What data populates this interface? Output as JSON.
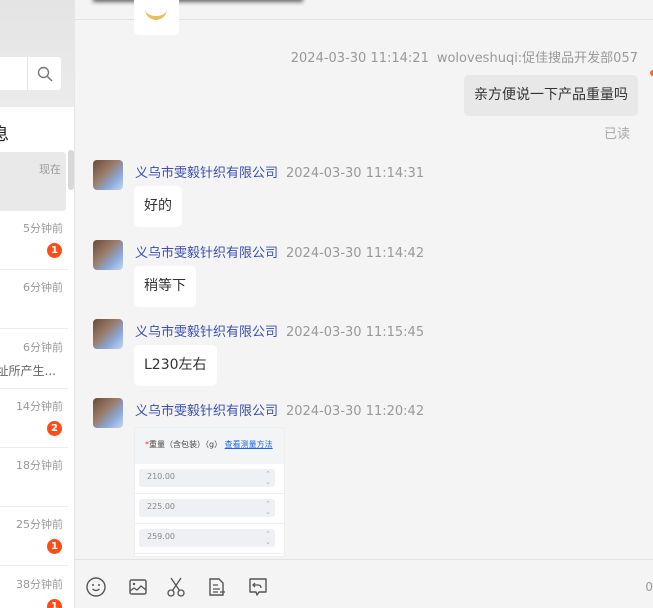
{
  "sidebar": {
    "list_heading": "息",
    "conversations": [
      {
        "time": "现在",
        "preview": "",
        "badge": ""
      },
      {
        "time": "5分钟前",
        "preview": "",
        "badge": "1"
      },
      {
        "time": "6分钟前",
        "preview": "",
        "badge": ""
      },
      {
        "time": "6分钟前",
        "preview": "址所产生...",
        "badge": ""
      },
      {
        "time": "14分钟前",
        "preview": "",
        "badge": "2"
      },
      {
        "time": "18分钟前",
        "preview": "",
        "badge": ""
      },
      {
        "time": "25分钟前",
        "preview": "",
        "badge": "1"
      },
      {
        "time": "38分钟前",
        "preview": "",
        "badge": "1"
      }
    ]
  },
  "chat": {
    "outgoing": {
      "time": "2024-03-30 11:14:21",
      "sender": "woloveshuqi:促佳搜品开发部057",
      "text": "亲方便说一下产品重量吗",
      "status": "已读"
    },
    "incoming": [
      {
        "sender": "义乌市雯毅针织有限公司",
        "time": "2024-03-30 11:14:31",
        "text": "好的"
      },
      {
        "sender": "义乌市雯毅针织有限公司",
        "time": "2024-03-30 11:14:42",
        "text": "稍等下"
      },
      {
        "sender": "义乌市雯毅针织有限公司",
        "time": "2024-03-30 11:15:45",
        "text": "L230左右"
      },
      {
        "sender": "义乌市雯毅针织有限公司",
        "time": "2024-03-30 11:20:42",
        "text": ""
      }
    ],
    "image": {
      "required_mark": "*",
      "label": "重量（含包装）（g）",
      "link": "查看测量方法",
      "values": [
        "210.00",
        "225.00",
        "259.00"
      ]
    }
  },
  "input": {
    "char_count": "0"
  }
}
